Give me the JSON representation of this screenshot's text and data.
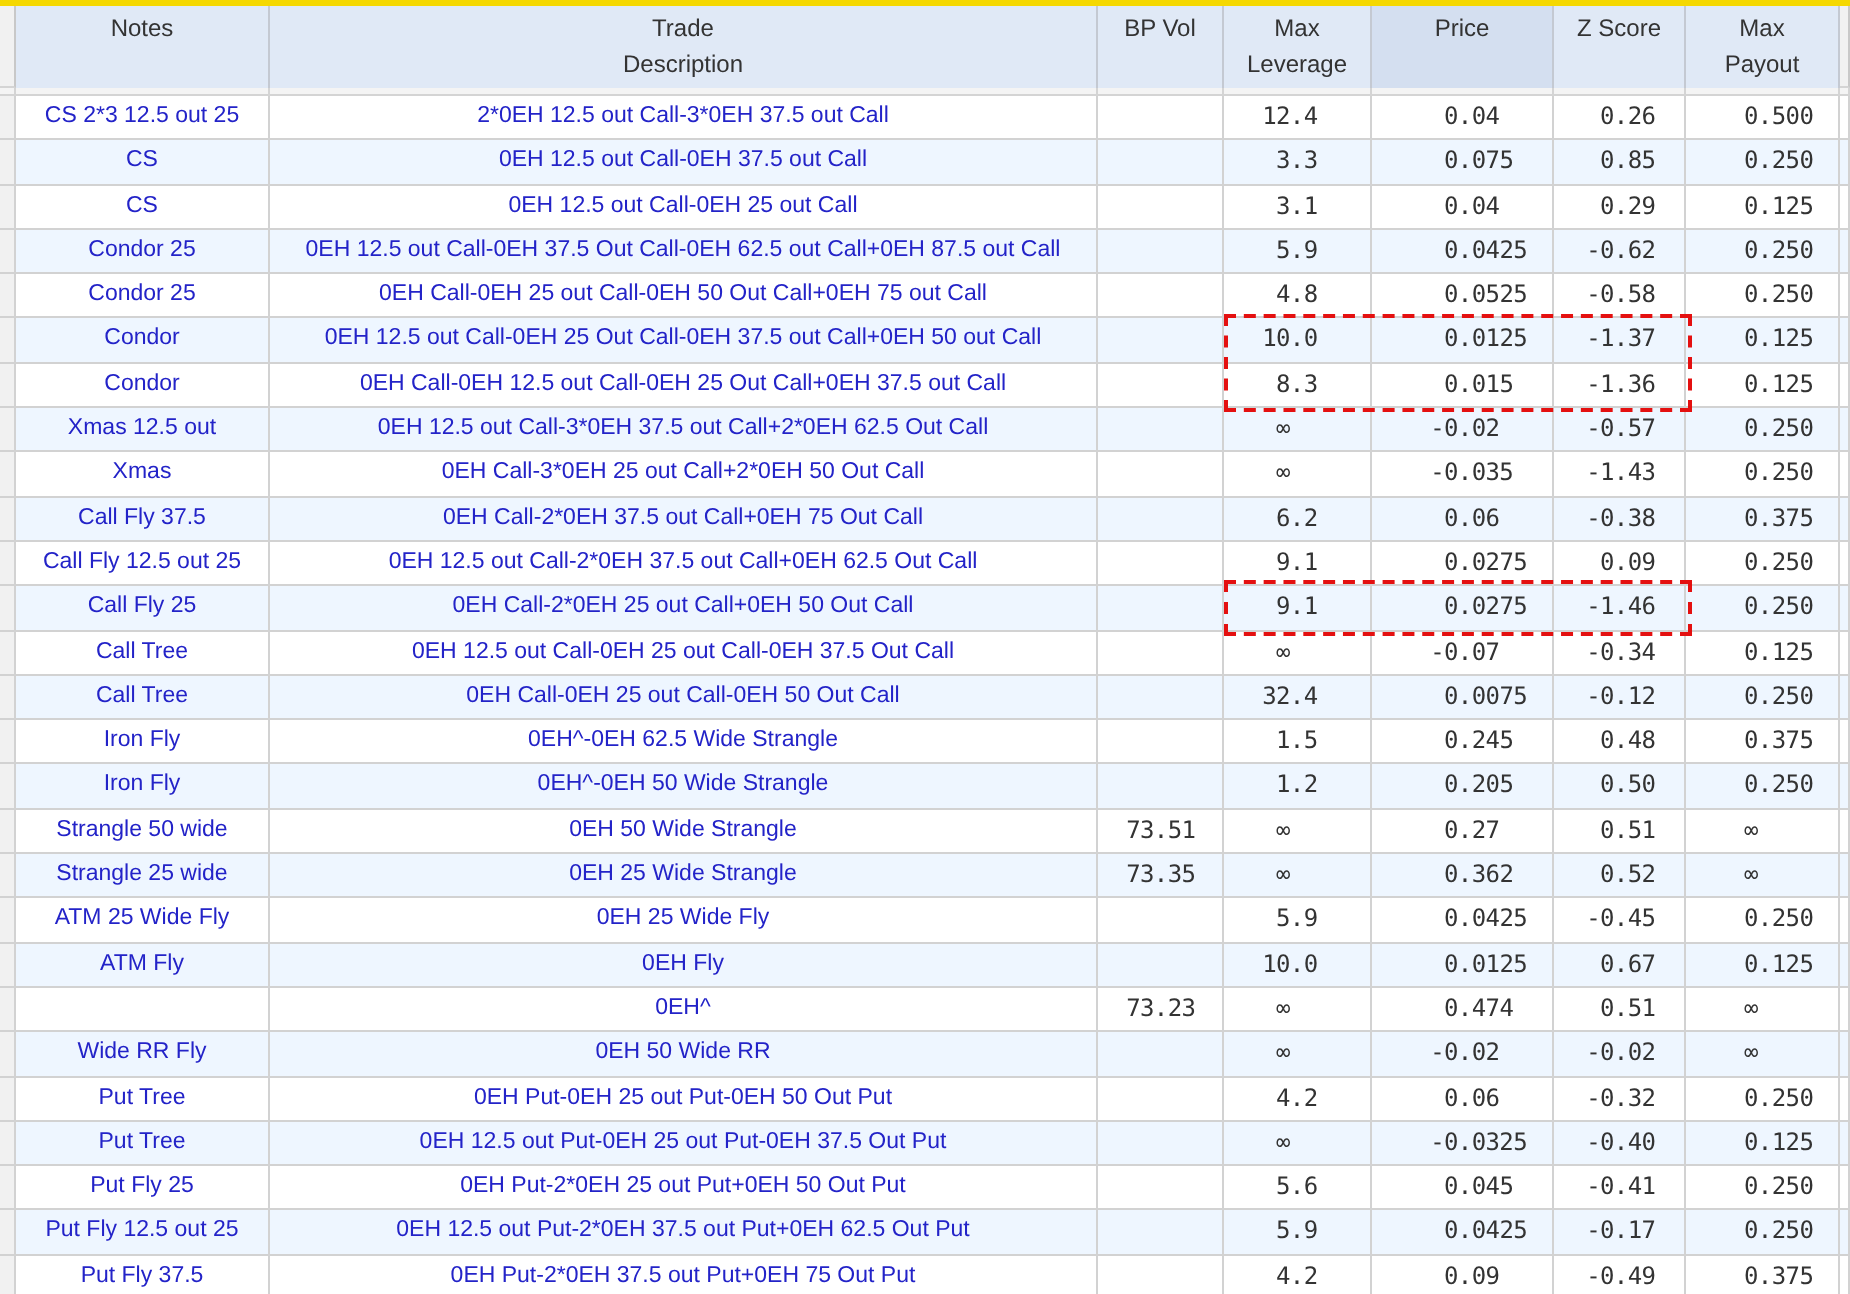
{
  "table": {
    "columns": [
      {
        "lines": [
          "Notes"
        ],
        "selected": false
      },
      {
        "lines": [
          "Trade",
          "Description"
        ],
        "selected": false
      },
      {
        "lines": [
          "BP Vol"
        ],
        "selected": false
      },
      {
        "lines": [
          "Max",
          "Leverage"
        ],
        "selected": false
      },
      {
        "lines": [
          "Price"
        ],
        "selected": true
      },
      {
        "lines": [
          "Z Score"
        ],
        "selected": false
      },
      {
        "lines": [
          "Max",
          "Payout"
        ],
        "selected": false
      }
    ],
    "rows": [
      {
        "notes": "CS 2*3 12.5 out 25",
        "description": "2*0EH 12.5 out Call-3*0EH 37.5 out Call",
        "max_leverage": "12.4",
        "price": "0.04",
        "z_score": "0.26",
        "max_payout": "0.500",
        "highlighted": false
      },
      {
        "notes": "CS",
        "description": "0EH 12.5 out Call-0EH 37.5 out Call",
        "max_leverage": "3.3",
        "price": "0.075",
        "z_score": "0.85",
        "max_payout": "0.250",
        "highlighted": false
      },
      {
        "notes": "CS",
        "description": "0EH 12.5 out Call-0EH 25 out Call",
        "max_leverage": "3.1",
        "price": "0.04",
        "z_score": "0.29",
        "max_payout": "0.125",
        "highlighted": false
      },
      {
        "notes": "Condor 25",
        "description": "0EH 12.5 out Call-0EH 37.5 Out Call-0EH 62.5 out Call+0EH 87.5 out Call",
        "max_leverage": "5.9",
        "price": "0.0425",
        "z_score": "-0.62",
        "max_payout": "0.250",
        "highlighted": false
      },
      {
        "notes": "Condor 25",
        "description": "0EH Call-0EH 25 out Call-0EH 50 Out Call+0EH 75 out Call",
        "max_leverage": "4.8",
        "price": "0.0525",
        "z_score": "-0.58",
        "max_payout": "0.250",
        "highlighted": false
      },
      {
        "notes": "Condor",
        "description": "0EH 12.5 out Call-0EH 25 Out Call-0EH 37.5 out Call+0EH 50 out Call",
        "max_leverage": "10.0",
        "price": "0.0125",
        "z_score": "-1.37",
        "max_payout": "0.125",
        "highlighted": true
      },
      {
        "notes": "Condor",
        "description": "0EH Call-0EH 12.5 out Call-0EH 25 Out Call+0EH 37.5 out Call",
        "max_leverage": "8.3",
        "price": "0.015",
        "z_score": "-1.36",
        "max_payout": "0.125",
        "highlighted": true
      },
      {
        "notes": "Xmas 12.5 out",
        "description": "0EH 12.5 out Call-3*0EH 37.5 out Call+2*0EH 62.5 Out Call",
        "max_leverage": "∞",
        "price": "-0.02",
        "z_score": "-0.57",
        "max_payout": "0.250",
        "highlighted": false
      },
      {
        "notes": "Xmas",
        "description": "0EH Call-3*0EH 25 out Call+2*0EH 50 Out Call",
        "max_leverage": "∞",
        "price": "-0.035",
        "z_score": "-1.43",
        "max_payout": "0.250",
        "highlighted": false
      },
      {
        "notes": "Call Fly 37.5",
        "description": "0EH Call-2*0EH 37.5 out Call+0EH 75 Out Call",
        "max_leverage": "6.2",
        "price": "0.06",
        "z_score": "-0.38",
        "max_payout": "0.375",
        "highlighted": false
      },
      {
        "notes": "Call Fly 12.5 out 25",
        "description": "0EH 12.5 out Call-2*0EH 37.5 out Call+0EH 62.5 Out Call",
        "max_leverage": "9.1",
        "price": "0.0275",
        "z_score": "0.09",
        "max_payout": "0.250",
        "highlighted": false
      },
      {
        "notes": "Call Fly 25",
        "description": "0EH Call-2*0EH 25 out Call+0EH 50 Out Call",
        "max_leverage": "9.1",
        "price": "0.0275",
        "z_score": "-1.46",
        "max_payout": "0.250",
        "highlighted": true
      },
      {
        "notes": "Call Tree",
        "description": "0EH 12.5 out Call-0EH 25 out Call-0EH 37.5 Out Call",
        "max_leverage": "∞",
        "price": "-0.07",
        "z_score": "-0.34",
        "max_payout": "0.125",
        "highlighted": false
      },
      {
        "notes": "Call Tree",
        "description": "0EH Call-0EH 25 out Call-0EH 50 Out Call",
        "max_leverage": "32.4",
        "price": "0.0075",
        "z_score": "-0.12",
        "max_payout": "0.250",
        "highlighted": false
      },
      {
        "notes": "Iron Fly",
        "description": "0EH^-0EH 62.5 Wide Strangle",
        "max_leverage": "1.5",
        "price": "0.245",
        "z_score": "0.48",
        "max_payout": "0.375",
        "highlighted": false
      },
      {
        "notes": "Iron Fly",
        "description": "0EH^-0EH 50 Wide Strangle",
        "max_leverage": "1.2",
        "price": "0.205",
        "z_score": "0.50",
        "max_payout": "0.250",
        "highlighted": false
      },
      {
        "notes": "Strangle 50 wide",
        "description": "0EH 50 Wide Strangle",
        "bp_vol": "73.51",
        "max_leverage": "∞",
        "price": "0.27",
        "z_score": "0.51",
        "max_payout": "∞",
        "highlighted": false
      },
      {
        "notes": "Strangle 25 wide",
        "description": "0EH 25 Wide Strangle",
        "bp_vol": "73.35",
        "max_leverage": "∞",
        "price": "0.362",
        "z_score": "0.52",
        "max_payout": "∞",
        "highlighted": false
      },
      {
        "notes": "ATM 25 Wide Fly",
        "description": "0EH 25 Wide Fly",
        "max_leverage": "5.9",
        "price": "0.0425",
        "z_score": "-0.45",
        "max_payout": "0.250",
        "highlighted": false
      },
      {
        "notes": "ATM Fly",
        "description": "0EH Fly",
        "max_leverage": "10.0",
        "price": "0.0125",
        "z_score": "0.67",
        "max_payout": "0.125",
        "highlighted": false
      },
      {
        "description": "0EH^",
        "bp_vol": "73.23",
        "max_leverage": "∞",
        "price": "0.474",
        "z_score": "0.51",
        "max_payout": "∞",
        "highlighted": false
      },
      {
        "notes": "Wide RR Fly",
        "description": "0EH 50 Wide RR",
        "max_leverage": "∞",
        "price": "-0.02",
        "z_score": "-0.02",
        "max_payout": "∞",
        "highlighted": false
      },
      {
        "notes": "Put Tree",
        "description": "0EH Put-0EH 25 out Put-0EH 50 Out Put",
        "max_leverage": "4.2",
        "price": "0.06",
        "z_score": "-0.32",
        "max_payout": "0.250",
        "highlighted": false
      },
      {
        "notes": "Put Tree",
        "description": "0EH 12.5 out Put-0EH 25 out Put-0EH 37.5 Out Put",
        "max_leverage": "∞",
        "price": "-0.0325",
        "z_score": "-0.40",
        "max_payout": "0.125",
        "highlighted": false
      },
      {
        "notes": "Put Fly 25",
        "description": "0EH Put-2*0EH 25 out Put+0EH 50 Out Put",
        "max_leverage": "5.6",
        "price": "0.045",
        "z_score": "-0.41",
        "max_payout": "0.250",
        "highlighted": false
      },
      {
        "notes": "Put Fly 12.5 out 25",
        "description": "0EH 12.5 out Put-2*0EH 37.5 out Put+0EH 62.5 Out Put",
        "max_leverage": "5.9",
        "price": "0.0425",
        "z_score": "-0.17",
        "max_payout": "0.250",
        "highlighted": false
      },
      {
        "notes": "Put Fly 37.5",
        "description": "0EH Put-2*0EH 37.5 out Put+0EH 75 Out Put",
        "max_leverage": "4.2",
        "price": "0.09",
        "z_score": "-0.49",
        "max_payout": "0.375",
        "highlighted": false
      }
    ]
  }
}
